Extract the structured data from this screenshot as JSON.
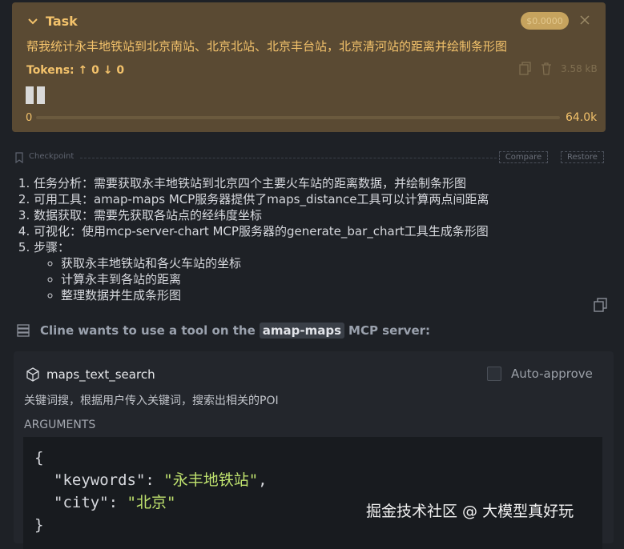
{
  "task": {
    "title": "Task",
    "badge": "$0.0000",
    "description": "帮我统计永丰地铁站到北京南站、北京北站、北京丰台站，北京清河站的距离并绘制条形图",
    "tokens_label": "Tokens:",
    "tokens_up": "0",
    "tokens_down": "0",
    "size": "3.58 kB",
    "context_min": "0",
    "context_max": "64.0k",
    "context_used_fraction": 0
  },
  "checkpoint": {
    "label": "Checkpoint",
    "compare": "Compare",
    "restore": "Restore"
  },
  "steps": [
    "任务分析：需要获取永丰地铁站到北京四个主要火车站的距离数据，并绘制条形图",
    "可用工具：amap-maps MCP服务器提供了maps_distance工具可以计算两点间距离",
    "数据获取：需要先获取各站点的经纬度坐标",
    "可视化：使用mcp-server-chart MCP服务器的generate_bar_chart工具生成条形图",
    "步骤："
  ],
  "substeps": [
    "获取永丰地铁站和各火车站的坐标",
    "计算永丰到各站的距离",
    "整理数据并生成条形图"
  ],
  "cline": {
    "prefix": "Cline wants to use a tool on the",
    "server": "amap-maps",
    "suffix": "MCP server:"
  },
  "tool": {
    "name": "maps_text_search",
    "auto_approve": "Auto-approve",
    "description": "关键词搜，根据用户传入关键词，搜索出相关的POI",
    "arguments_label": "ARGUMENTS",
    "args": {
      "open": "{",
      "k1": "\"keywords\"",
      "v1": "\"永丰地铁站\"",
      "k2": "\"city\"",
      "v2": "\"北京\"",
      "close": "}"
    }
  },
  "watermark": "掘金技术社区 @ 大模型真好玩",
  "colors": {
    "task_bg": "#5a4a33",
    "task_text": "#f3c26b",
    "string": "#bfe26e"
  }
}
